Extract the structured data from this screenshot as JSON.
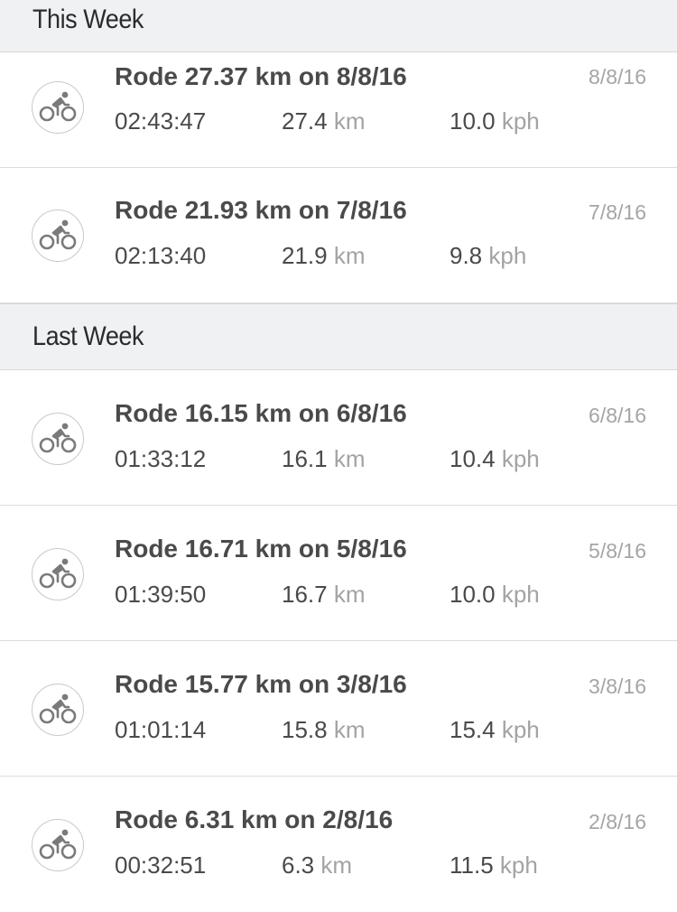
{
  "sections": [
    {
      "header": "This Week",
      "rides": [
        {
          "title": "Rode 27.37 km on 8/8/16",
          "date": "8/8/16",
          "duration": "02:43:47",
          "distance": "27.4",
          "distance_unit": "km",
          "speed": "10.0",
          "speed_unit": "kph",
          "icon": "cycling-icon"
        },
        {
          "title": "Rode 21.93 km on 7/8/16",
          "date": "7/8/16",
          "duration": "02:13:40",
          "distance": "21.9",
          "distance_unit": "km",
          "speed": "9.8",
          "speed_unit": "kph",
          "icon": "cycling-icon"
        }
      ]
    },
    {
      "header": "Last Week",
      "rides": [
        {
          "title": "Rode 16.15 km on 6/8/16",
          "date": "6/8/16",
          "duration": "01:33:12",
          "distance": "16.1",
          "distance_unit": "km",
          "speed": "10.4",
          "speed_unit": "kph",
          "icon": "cycling-icon"
        },
        {
          "title": "Rode 16.71 km on 5/8/16",
          "date": "5/8/16",
          "duration": "01:39:50",
          "distance": "16.7",
          "distance_unit": "km",
          "speed": "10.0",
          "speed_unit": "kph",
          "icon": "cycling-icon"
        },
        {
          "title": "Rode 15.77 km on 3/8/16",
          "date": "3/8/16",
          "duration": "01:01:14",
          "distance": "15.8",
          "distance_unit": "km",
          "speed": "15.4",
          "speed_unit": "kph",
          "icon": "cycling-icon"
        },
        {
          "title": "Rode 6.31 km on 2/8/16",
          "date": "2/8/16",
          "duration": "00:32:51",
          "distance": "6.3",
          "distance_unit": "km",
          "speed": "11.5",
          "speed_unit": "kph",
          "icon": "cycling-icon"
        }
      ]
    }
  ]
}
